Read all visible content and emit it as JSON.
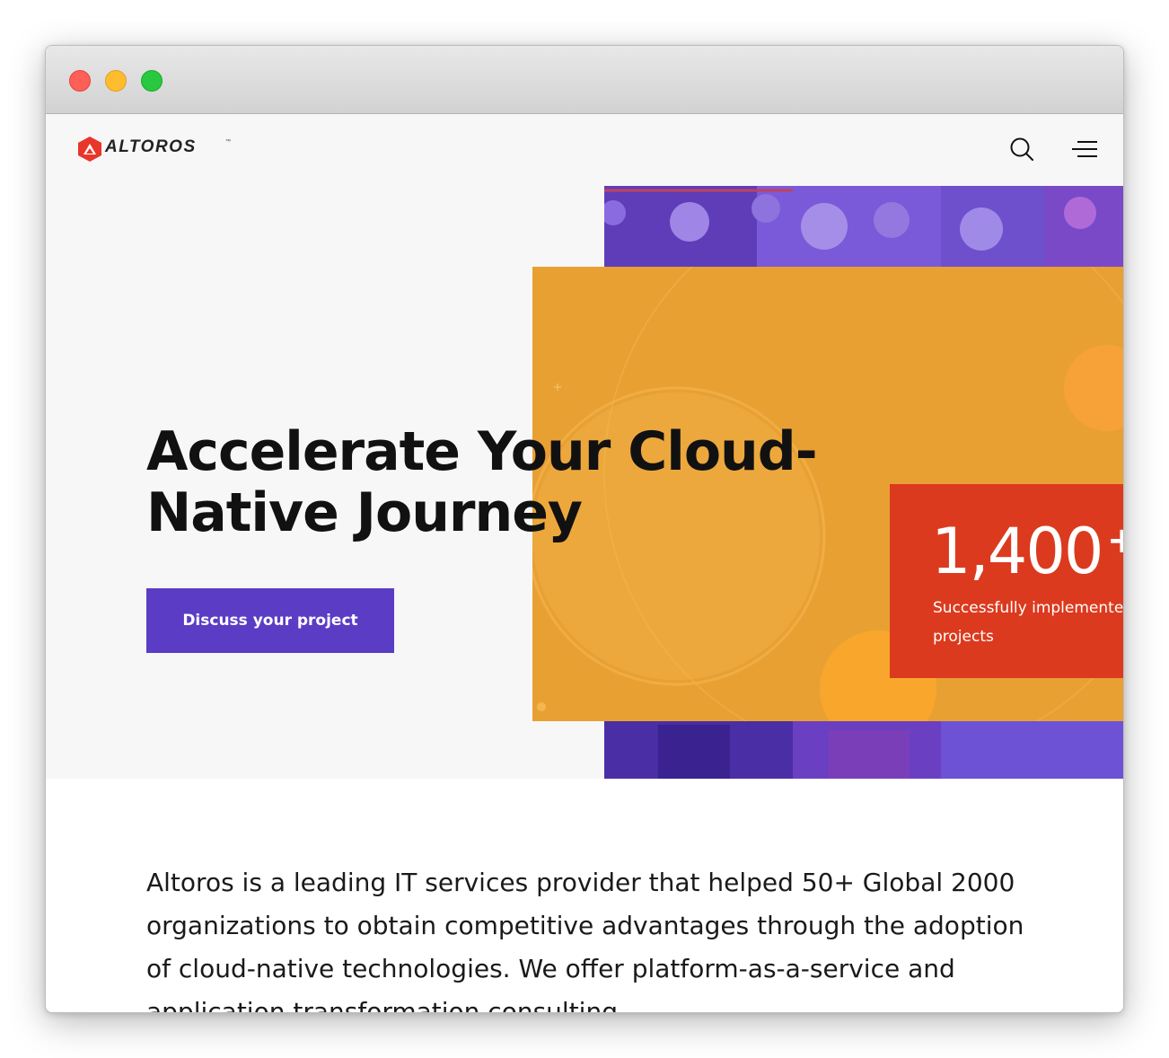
{
  "window": {
    "controls": [
      "close",
      "minimize",
      "zoom"
    ]
  },
  "header": {
    "logo_text": "ALTOROS",
    "logo_trademark": "™",
    "search_icon": "search-icon",
    "menu_icon": "hamburger-menu-icon"
  },
  "hero": {
    "headline": "Accelerate Your Cloud-Native Journey",
    "cta_label": "Discuss your project",
    "stat": {
      "number": "1,400",
      "plus": "+",
      "label_line1": "Successfully implemented",
      "label_line2": "projects"
    }
  },
  "intro": {
    "text": "Altoros is a leading IT services provider that helped 50+ Global 2000 organizations to obtain competitive advantages through the adoption of cloud-native technologies. We offer platform-as-a-service and application transformation consulting"
  },
  "colors": {
    "accent_purple": "#5b3cc4",
    "photo_purple": "#6c4ad1",
    "card_orange": "#e9a033",
    "stat_red": "#dc3a1e",
    "logo_red": "#e8362a",
    "hero_bg": "#f7f7f7"
  }
}
